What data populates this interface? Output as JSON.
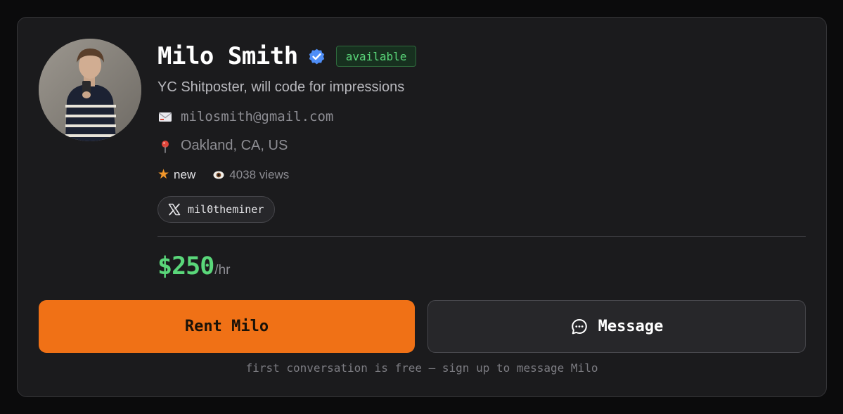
{
  "profile": {
    "name": "Milo Smith",
    "verified_icon": "verified-badge-icon",
    "status": "available",
    "tagline": "YC Shitposter, will code for impressions",
    "email": "milosmith@gmail.com",
    "location": "Oakland, CA, US",
    "rating_label": "new",
    "views": "4038 views",
    "social": {
      "platform_icon": "x-logo-icon",
      "handle": "mil0theminer"
    }
  },
  "pricing": {
    "amount": "$250",
    "unit": "/hr"
  },
  "actions": {
    "rent_label": "Rent Milo",
    "message_label": "Message",
    "footnote": "first conversation is free — sign up to message Milo"
  },
  "colors": {
    "accent_orange": "#f07116",
    "price_green": "#5ad77a",
    "verified_blue": "#3b82f6",
    "card_bg": "#1b1b1d"
  }
}
